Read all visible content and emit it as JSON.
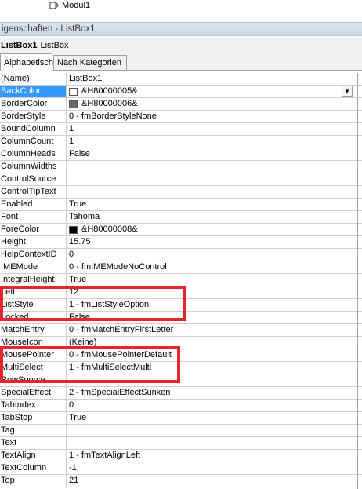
{
  "tree": {
    "item_label": "Modul1"
  },
  "panel": {
    "title": "igenschaften - ListBox1"
  },
  "object_selector": {
    "name": "ListBox1",
    "type": "ListBox"
  },
  "tabs": [
    {
      "label": "Alphabetisch"
    },
    {
      "label": "Nach Kategorien"
    }
  ],
  "properties": [
    {
      "name": "(Name)",
      "value": "ListBox1"
    },
    {
      "name": "BackColor",
      "value": "&H80000005&",
      "swatch": "#ffffff"
    },
    {
      "name": "BorderColor",
      "value": "&H80000006&",
      "swatch": "#666666"
    },
    {
      "name": "BorderStyle",
      "value": "0 - fmBorderStyleNone"
    },
    {
      "name": "BoundColumn",
      "value": "1"
    },
    {
      "name": "ColumnCount",
      "value": "1"
    },
    {
      "name": "ColumnHeads",
      "value": "False"
    },
    {
      "name": "ColumnWidths",
      "value": ""
    },
    {
      "name": "ControlSource",
      "value": ""
    },
    {
      "name": "ControlTipText",
      "value": ""
    },
    {
      "name": "Enabled",
      "value": "True"
    },
    {
      "name": "Font",
      "value": "Tahoma"
    },
    {
      "name": "ForeColor",
      "value": "&H80000008&",
      "swatch": "#000000"
    },
    {
      "name": "Height",
      "value": "15.75"
    },
    {
      "name": "HelpContextID",
      "value": "0"
    },
    {
      "name": "IMEMode",
      "value": "0 - fmIMEModeNoControl"
    },
    {
      "name": "IntegralHeight",
      "value": "True"
    },
    {
      "name": "Left",
      "value": "12"
    },
    {
      "name": "ListStyle",
      "value": "1 - fmListStyleOption"
    },
    {
      "name": "Locked",
      "value": "False"
    },
    {
      "name": "MatchEntry",
      "value": "0 - fmMatchEntryFirstLetter"
    },
    {
      "name": "MouseIcon",
      "value": "(Keine)"
    },
    {
      "name": "MousePointer",
      "value": "0 - fmMousePointerDefault"
    },
    {
      "name": "MultiSelect",
      "value": "1 - fmMultiSelectMulti"
    },
    {
      "name": "RowSource",
      "value": ""
    },
    {
      "name": "SpecialEffect",
      "value": "2 - fmSpecialEffectSunken"
    },
    {
      "name": "TabIndex",
      "value": "0"
    },
    {
      "name": "TabStop",
      "value": "True"
    },
    {
      "name": "Tag",
      "value": ""
    },
    {
      "name": "Text",
      "value": ""
    },
    {
      "name": "TextAlign",
      "value": "1 - fmTextAlignLeft"
    },
    {
      "name": "TextColumn",
      "value": "-1"
    },
    {
      "name": "Top",
      "value": "21"
    }
  ],
  "colors": {
    "selection": "#3399ff",
    "annotation": "#e8252e"
  },
  "icons": {
    "module": "module-icon",
    "dropdown": "chevron-down-icon"
  }
}
